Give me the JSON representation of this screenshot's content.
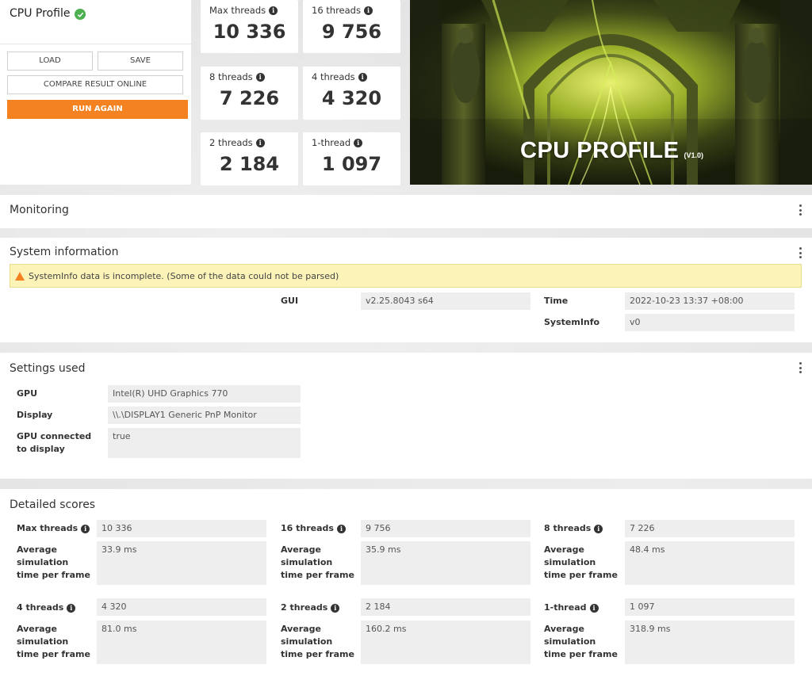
{
  "profile": {
    "title": "CPU Profile",
    "load_label": "LOAD",
    "save_label": "SAVE",
    "compare_label": "COMPARE RESULT ONLINE",
    "run_again_label": "RUN AGAIN"
  },
  "scores": [
    {
      "label": "Max threads",
      "value": "10 336"
    },
    {
      "label": "16 threads",
      "value": "9 756"
    },
    {
      "label": "8 threads",
      "value": "7 226"
    },
    {
      "label": "4 threads",
      "value": "4 320"
    },
    {
      "label": "2 threads",
      "value": "2 184"
    },
    {
      "label": "1-thread",
      "value": "1 097"
    }
  ],
  "hero": {
    "title": "CPU PROFILE",
    "version": "(V1.0)"
  },
  "monitoring": {
    "title": "Monitoring"
  },
  "system_info": {
    "title": "System information",
    "warning": "SystemInfo data is incomplete. (Some of the data could not be parsed)",
    "gui_label": "GUI",
    "gui_value": "v2.25.8043 s64",
    "time_label": "Time",
    "time_value": "2022-10-23 13:37 +08:00",
    "systeminfo_label": "SystemInfo",
    "systeminfo_value": "v0"
  },
  "settings": {
    "title": "Settings used",
    "gpu_label": "GPU",
    "gpu_value": "Intel(R) UHD Graphics 770",
    "display_label": "Display",
    "display_value": "\\\\.\\DISPLAY1 Generic PnP Monitor",
    "gpu_connected_label": "GPU connected to display",
    "gpu_connected_value": "true"
  },
  "detailed": {
    "title": "Detailed scores",
    "avg_label": "Average simulation time per frame",
    "items": [
      {
        "label": "Max threads",
        "score": "10 336",
        "avg": "33.9 ms"
      },
      {
        "label": "16 threads",
        "score": "9 756",
        "avg": "35.9 ms"
      },
      {
        "label": "8 threads",
        "score": "7 226",
        "avg": "48.4 ms"
      },
      {
        "label": "4 threads",
        "score": "4 320",
        "avg": "81.0 ms"
      },
      {
        "label": "2 threads",
        "score": "2 184",
        "avg": "160.2 ms"
      },
      {
        "label": "1-thread",
        "score": "1 097",
        "avg": "318.9 ms"
      }
    ]
  },
  "colors": {
    "accent": "#f58220",
    "success": "#4caf50",
    "warning_bg": "#fcf3b8"
  }
}
